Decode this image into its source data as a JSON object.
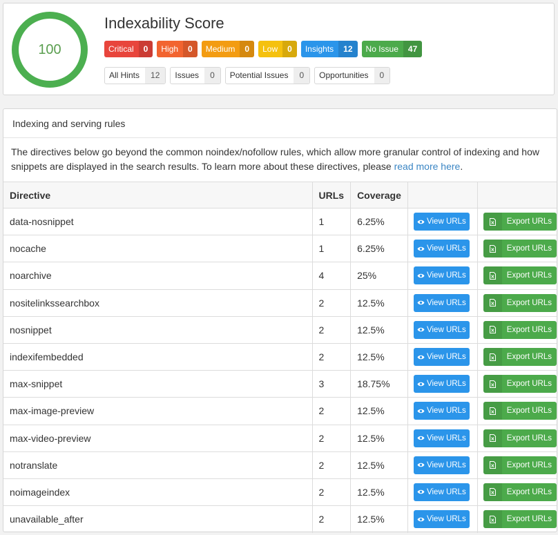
{
  "score": {
    "value": "100",
    "title": "Indexability Score",
    "ring_color": "#4caf50",
    "badges": [
      {
        "label": "Critical",
        "count": "0",
        "color": "#e8453c"
      },
      {
        "label": "High",
        "count": "0",
        "color": "#f26430"
      },
      {
        "label": "Medium",
        "count": "0",
        "color": "#f39c12"
      },
      {
        "label": "Low",
        "count": "0",
        "color": "#f5c10e"
      },
      {
        "label": "Insights",
        "count": "12",
        "color": "#2b95ea"
      },
      {
        "label": "No Issue",
        "count": "47",
        "color": "#4caa4b"
      }
    ],
    "hints": [
      {
        "label": "All Hints",
        "count": "12"
      },
      {
        "label": "Issues",
        "count": "0"
      },
      {
        "label": "Potential Issues",
        "count": "0"
      },
      {
        "label": "Opportunities",
        "count": "0"
      }
    ]
  },
  "rules": {
    "header": "Indexing and serving rules",
    "description": "The directives below go beyond the common noindex/nofollow rules, which allow more granular control of indexing and how snippets are displayed in the search results. To learn more about these directives, please ",
    "link_text": "read more here",
    "description_end": ".",
    "columns": {
      "directive": "Directive",
      "urls": "URLs",
      "coverage": "Coverage"
    },
    "view_label": "View URLs",
    "export_label": "Export URLs",
    "rows": [
      {
        "directive": "data-nosnippet",
        "urls": "1",
        "coverage": "6.25%"
      },
      {
        "directive": "nocache",
        "urls": "1",
        "coverage": "6.25%"
      },
      {
        "directive": "noarchive",
        "urls": "4",
        "coverage": "25%"
      },
      {
        "directive": "nositelinkssearchbox",
        "urls": "2",
        "coverage": "12.5%"
      },
      {
        "directive": "nosnippet",
        "urls": "2",
        "coverage": "12.5%"
      },
      {
        "directive": "indexifembedded",
        "urls": "2",
        "coverage": "12.5%"
      },
      {
        "directive": "max-snippet",
        "urls": "3",
        "coverage": "18.75%"
      },
      {
        "directive": "max-image-preview",
        "urls": "2",
        "coverage": "12.5%"
      },
      {
        "directive": "max-video-preview",
        "urls": "2",
        "coverage": "12.5%"
      },
      {
        "directive": "notranslate",
        "urls": "2",
        "coverage": "12.5%"
      },
      {
        "directive": "noimageindex",
        "urls": "2",
        "coverage": "12.5%"
      },
      {
        "directive": "unavailable_after",
        "urls": "2",
        "coverage": "12.5%"
      }
    ]
  }
}
